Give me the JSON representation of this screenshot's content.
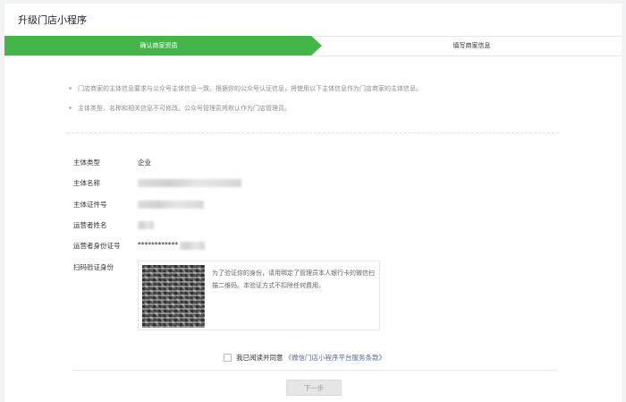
{
  "page": {
    "title": "升级门店小程序"
  },
  "steps": [
    {
      "label": "确认商家资质",
      "active": true
    },
    {
      "label": "填写商家信息",
      "active": false
    }
  ],
  "notes": [
    "门店商家的主体信息要求与公众号主体信息一致。根据你的公众号认证信息，将使用以下主体信息作为门店商家的主体信息。",
    "主体类型、名称和相关信息不可修改。公众号管理员将默认作为门店管理员。"
  ],
  "fields": [
    {
      "label": "主体类型",
      "value": "企业"
    },
    {
      "label": "主体名称",
      "value": ""
    },
    {
      "label": "主体证件号",
      "value": ""
    },
    {
      "label": "运营者姓名",
      "value": ""
    },
    {
      "label": "运营者身份证号",
      "value": "************"
    },
    {
      "label": "扫码验证身份",
      "value": ""
    }
  ],
  "qr": {
    "description": "为了验证你的身份，请用绑定了管理员本人银行卡的微信扫描二维码。本验证方式不扣除任何费用。"
  },
  "agreement": {
    "text": "我已阅读并同意",
    "link": "《微信门店小程序平台服务条款》"
  },
  "next_button": {
    "label": "下一步",
    "enabled": false
  },
  "colors": {
    "accent": "#44b549",
    "link": "#576b95"
  }
}
